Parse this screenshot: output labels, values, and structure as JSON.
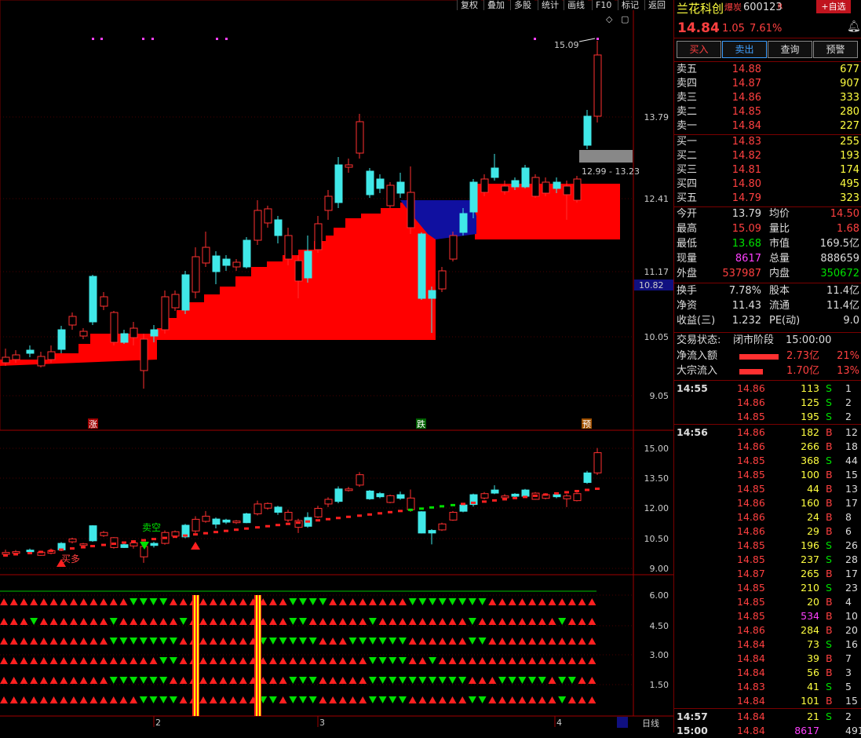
{
  "toolbar": [
    "复权",
    "叠加",
    "多股",
    "统计",
    "画线",
    "F10",
    "标记",
    "返回"
  ],
  "stock": {
    "name": "兰花科创",
    "tag": "爆炭",
    "code": "600123",
    "r_badge": "R",
    "fav_label": "+自选",
    "price": "14.84",
    "change": "1.05",
    "pct": "7.61%"
  },
  "actions": [
    "买入",
    "卖出",
    "查询",
    "预警"
  ],
  "asks": [
    {
      "label": "卖五",
      "price": "14.88",
      "vol": "677"
    },
    {
      "label": "卖四",
      "price": "14.87",
      "vol": "907"
    },
    {
      "label": "卖三",
      "price": "14.86",
      "vol": "333"
    },
    {
      "label": "卖二",
      "price": "14.85",
      "vol": "280"
    },
    {
      "label": "卖一",
      "price": "14.84",
      "vol": "227"
    }
  ],
  "bids": [
    {
      "label": "买一",
      "price": "14.83",
      "vol": "255"
    },
    {
      "label": "买二",
      "price": "14.82",
      "vol": "193"
    },
    {
      "label": "买三",
      "price": "14.81",
      "vol": "174"
    },
    {
      "label": "买四",
      "price": "14.80",
      "vol": "495"
    },
    {
      "label": "买五",
      "price": "14.79",
      "vol": "323"
    }
  ],
  "stats": [
    {
      "l1": "今开",
      "v1": "13.79",
      "l2": "均价",
      "v2": "14.50"
    },
    {
      "l1": "最高",
      "v1": "15.09",
      "l2": "量比",
      "v2": "1.68"
    },
    {
      "l1": "最低",
      "v1": "13.68",
      "l2": "市值",
      "v2": "169.5亿"
    },
    {
      "l1": "现量",
      "v1": "8617",
      "l2": "总量",
      "v2": "888659"
    },
    {
      "l1": "外盘",
      "v1": "537987",
      "l2": "内盘",
      "v2": "350672"
    }
  ],
  "stats2": [
    {
      "l1": "换手",
      "v1": "7.78%",
      "l2": "股本",
      "v2": "11.4亿"
    },
    {
      "l1": "净资",
      "v1": "11.43",
      "l2": "流通",
      "v2": "11.4亿"
    },
    {
      "l1": "收益(三)",
      "v1": "1.232",
      "l2": "PE(动)",
      "v2": "9.0"
    }
  ],
  "trade_status": {
    "label": "交易状态:",
    "value": "闭市阶段",
    "time": "15:00:00"
  },
  "flows": [
    {
      "label": "净流入额",
      "value": "2.73亿",
      "pct": "21%"
    },
    {
      "label": "大宗流入",
      "value": "1.70亿",
      "pct": "13%"
    }
  ],
  "ticks": [
    {
      "t": "14:55",
      "p": "14.86",
      "v": "113",
      "s": "S",
      "n": "1"
    },
    {
      "t": "",
      "p": "14.86",
      "v": "125",
      "s": "S",
      "n": "2"
    },
    {
      "t": "",
      "p": "14.85",
      "v": "195",
      "s": "S",
      "n": "2"
    },
    {
      "t": "14:56",
      "p": "14.86",
      "v": "182",
      "s": "B",
      "n": "12"
    },
    {
      "t": "",
      "p": "14.86",
      "v": "266",
      "s": "B",
      "n": "18"
    },
    {
      "t": "",
      "p": "14.85",
      "v": "368",
      "s": "S",
      "n": "44"
    },
    {
      "t": "",
      "p": "14.85",
      "v": "100",
      "s": "B",
      "n": "15"
    },
    {
      "t": "",
      "p": "14.85",
      "v": "44",
      "s": "B",
      "n": "13"
    },
    {
      "t": "",
      "p": "14.86",
      "v": "160",
      "s": "B",
      "n": "17"
    },
    {
      "t": "",
      "p": "14.86",
      "v": "24",
      "s": "B",
      "n": "8"
    },
    {
      "t": "",
      "p": "14.86",
      "v": "29",
      "s": "B",
      "n": "6"
    },
    {
      "t": "",
      "p": "14.85",
      "v": "196",
      "s": "S",
      "n": "26"
    },
    {
      "t": "",
      "p": "14.85",
      "v": "237",
      "s": "S",
      "n": "28"
    },
    {
      "t": "",
      "p": "14.87",
      "v": "265",
      "s": "B",
      "n": "17"
    },
    {
      "t": "",
      "p": "14.85",
      "v": "210",
      "s": "S",
      "n": "23"
    },
    {
      "t": "",
      "p": "14.85",
      "v": "20",
      "s": "B",
      "n": "4"
    },
    {
      "t": "",
      "p": "14.85",
      "v": "534",
      "s": "B",
      "n": "10"
    },
    {
      "t": "",
      "p": "14.86",
      "v": "284",
      "s": "B",
      "n": "20"
    },
    {
      "t": "",
      "p": "14.84",
      "v": "73",
      "s": "S",
      "n": "16"
    },
    {
      "t": "",
      "p": "14.84",
      "v": "39",
      "s": "B",
      "n": "7"
    },
    {
      "t": "",
      "p": "14.84",
      "v": "56",
      "s": "B",
      "n": "3"
    },
    {
      "t": "",
      "p": "14.83",
      "v": "41",
      "s": "S",
      "n": "5"
    },
    {
      "t": "",
      "p": "14.84",
      "v": "101",
      "s": "B",
      "n": "15"
    },
    {
      "t": "14:57",
      "p": "14.84",
      "v": "21",
      "s": "S",
      "n": "2"
    },
    {
      "t": "15:00",
      "p": "14.84",
      "v": "8617",
      "s": "",
      "n": "491"
    }
  ],
  "chart": {
    "main_axis": [
      "13.79",
      "12.41",
      "11.17",
      "10.05",
      "9.05"
    ],
    "price_tag": "10.82",
    "high_label": "15.09",
    "range_label": "12.99 - 13.23",
    "markers": [
      "涨",
      "跌",
      "预"
    ],
    "mid_axis": [
      "15.00",
      "13.50",
      "12.00",
      "10.50",
      "9.00"
    ],
    "mid_labels": [
      "卖空",
      "买多"
    ],
    "low_axis": [
      "6.00",
      "4.50",
      "3.00",
      "1.50"
    ],
    "months": [
      "2",
      "3",
      "4"
    ],
    "period": "日线"
  }
}
